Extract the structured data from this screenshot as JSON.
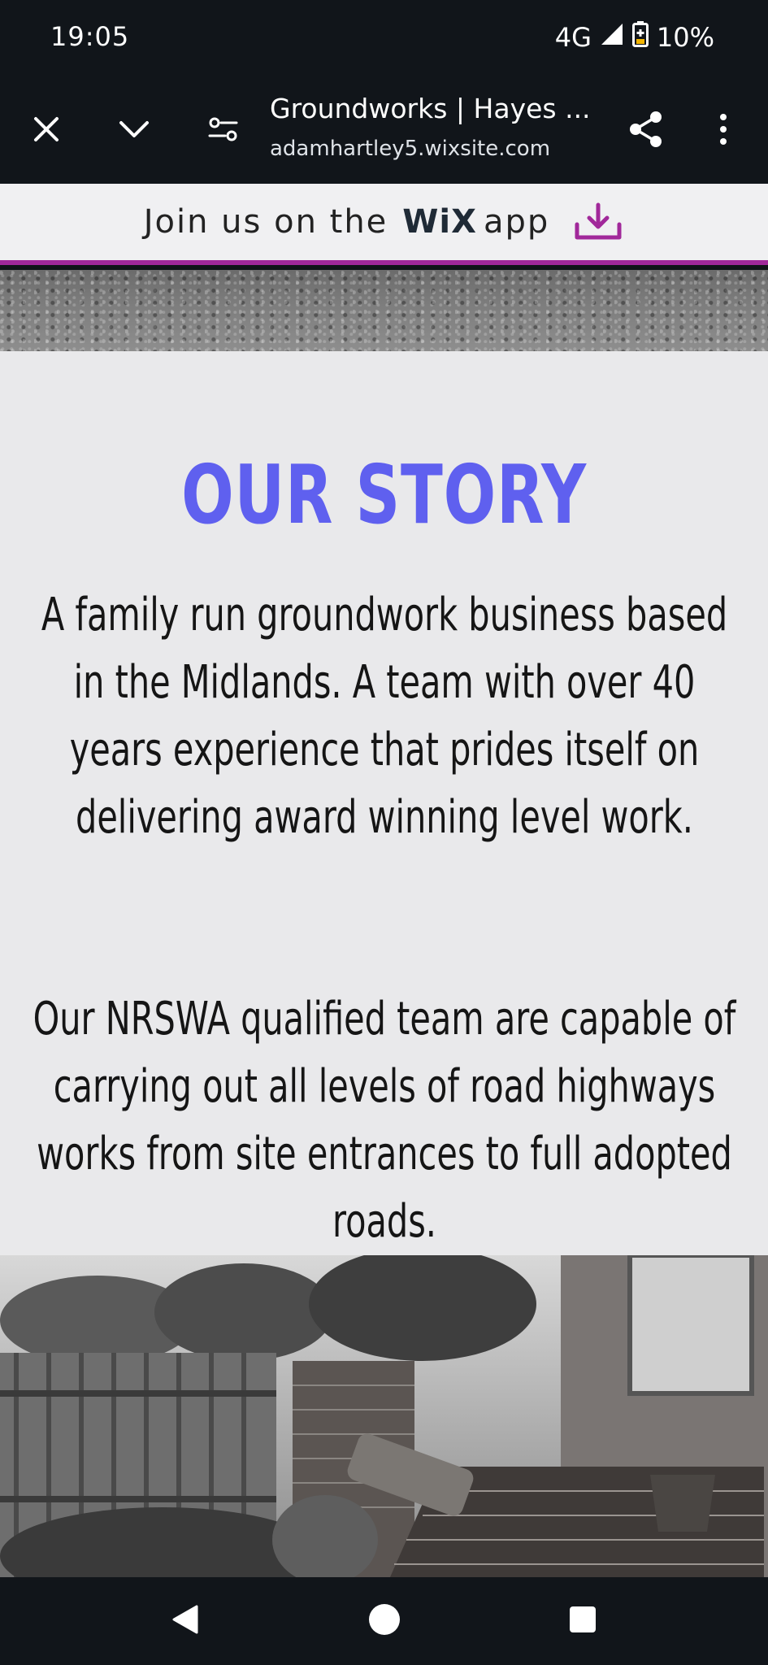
{
  "status_bar": {
    "time": "19:05",
    "network": "4G",
    "battery": "10%"
  },
  "toolbar": {
    "title": "Groundworks | Hayes ...",
    "url": "adamhartley5.wixsite.com"
  },
  "wix_banner": {
    "text_prefix": "Join us on the",
    "logo": "WiX",
    "text_suffix": "app"
  },
  "story": {
    "title": "OUR STORY",
    "paragraph1": "A family run groundwork business based in the Midlands. A team with over 40 years experience that prides itself on delivering award winning level work.",
    "paragraph2": "Our NRSWA qualified team are capable of carrying out all levels of road highways works from site entrances to full adopted roads."
  },
  "colors": {
    "accent_title": "#5f60ef",
    "wix_underline": "#a1289a",
    "bar_background": "#11151a"
  },
  "icons": {
    "close": "close-icon",
    "dropdown": "chevron-down-icon",
    "site_settings": "tune-icon",
    "share": "share-icon",
    "more": "more-vert-icon",
    "download": "download-icon",
    "back": "back-icon",
    "home": "home-icon",
    "recents": "recents-icon"
  }
}
